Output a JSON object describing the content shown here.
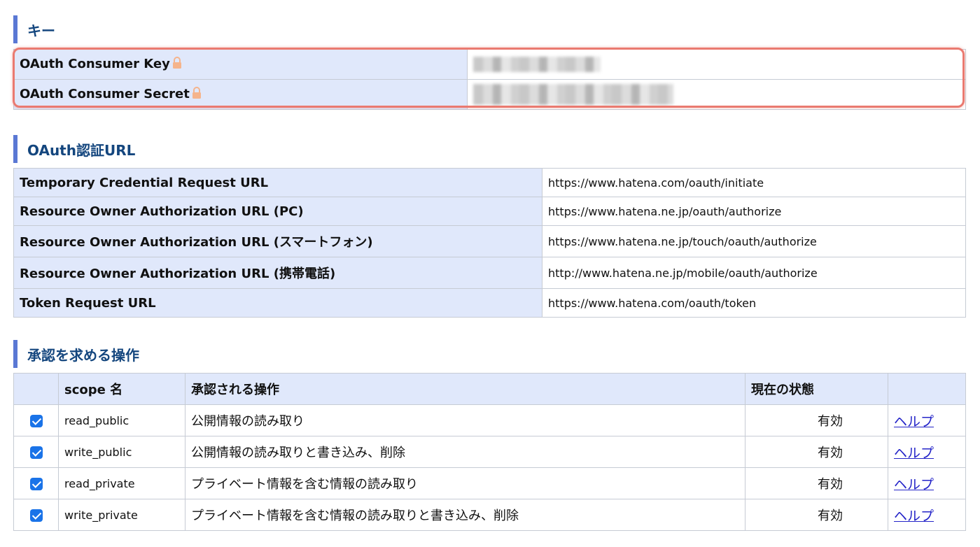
{
  "sections": {
    "key": "キー",
    "oauth_urls": "OAuth認証URL",
    "scopes": "承認を求める操作"
  },
  "key_table": [
    {
      "label": "OAuth Consumer Key"
    },
    {
      "label": "OAuth Consumer Secret"
    }
  ],
  "url_table": [
    {
      "label": "Temporary Credential Request URL",
      "value": "https://www.hatena.com/oauth/initiate"
    },
    {
      "label": "Resource Owner Authorization URL (PC)",
      "value": "https://www.hatena.ne.jp/oauth/authorize"
    },
    {
      "label": "Resource Owner Authorization URL (スマートフォン)",
      "value": "https://www.hatena.ne.jp/touch/oauth/authorize"
    },
    {
      "label": "Resource Owner Authorization URL (携帯電話)",
      "value": "http://www.hatena.ne.jp/mobile/oauth/authorize"
    },
    {
      "label": "Token Request URL",
      "value": "https://www.hatena.com/oauth/token"
    }
  ],
  "scope_table": {
    "headers": {
      "scope": "scope 名",
      "operation": "承認される操作",
      "state": "現在の状態"
    },
    "rows": [
      {
        "checked": true,
        "scope": "read_public",
        "operation": "公開情報の読み取り",
        "state": "有効",
        "help": "ヘルプ"
      },
      {
        "checked": true,
        "scope": "write_public",
        "operation": "公開情報の読み取りと書き込み、削除",
        "state": "有効",
        "help": "ヘルプ"
      },
      {
        "checked": true,
        "scope": "read_private",
        "operation": "プライベート情報を含む情報の読み取り",
        "state": "有効",
        "help": "ヘルプ"
      },
      {
        "checked": true,
        "scope": "write_private",
        "operation": "プライベート情報を含む情報の読み取りと書き込み、削除",
        "state": "有効",
        "help": "ヘルプ"
      }
    ]
  },
  "icons": {
    "lock": "lock-icon",
    "checkbox": "checkbox-checked-icon"
  },
  "colors": {
    "accent_bar": "#5a78d4",
    "heading": "#14467e",
    "label_bg": "#e0e8fb",
    "highlight": "#ea7a70",
    "link": "#2424c8"
  }
}
